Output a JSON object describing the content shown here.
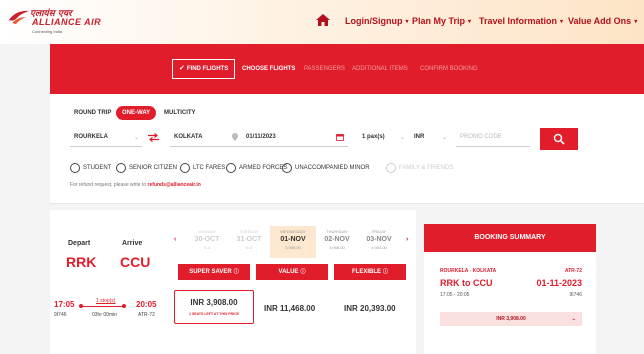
{
  "header": {
    "logo_hindi": "एलायंस एयर",
    "logo_name": "ALLIANCE AIR",
    "logo_tagline": "Connecting India",
    "nav": [
      {
        "label": "Login/Signup",
        "caret": "▾"
      },
      {
        "label": "Plan My Trip",
        "caret": "▾"
      },
      {
        "label": "Travel Information",
        "caret": "▾"
      },
      {
        "label": "Value Add Ons",
        "caret": "▾"
      }
    ]
  },
  "steps": {
    "find_flights": "FIND FLIGHTS",
    "tick": "✓",
    "choose_flights": "CHOOSE FLIGHTS",
    "passengers": "PASSENGERS",
    "additional_items": "ADDITIONAL ITEMS",
    "confirm_booking": "CONFIRM BOOKING"
  },
  "search": {
    "trip_types": [
      "ROUND TRIP",
      "ONE-WAY",
      "MULTICITY"
    ],
    "selected_trip": "ONE-WAY",
    "from": "ROURKELA",
    "to": "KOLKATA",
    "date": "01/11/2023",
    "pax": "1 pax(s)",
    "currency": "INR",
    "promo_placeholder": "PROMO CODE",
    "fare_types": [
      "STUDENT",
      "SENIOR CITIZEN",
      "LTC FARES",
      "ARMED FORCES",
      "UNACCOMPANIED MINOR",
      "FAMILY & FRIENDS"
    ],
    "refund_text": "For refund request, please write to",
    "refund_email": "refunds@allianceair.in"
  },
  "results": {
    "depart_label": "Depart",
    "arrive_label": "Arrive",
    "from_code": "RRK",
    "to_code": "CCU",
    "prev": "‹",
    "next": "›",
    "dates": [
      {
        "dow": "MONDAY",
        "dm": "30-OCT",
        "price": "N.A"
      },
      {
        "dow": "TUESDAY",
        "dm": "31-OCT",
        "price": "N.A"
      },
      {
        "dow": "WEDNESDAY",
        "dm": "01-NOV",
        "price": "3,908.00"
      },
      {
        "dow": "THURSDAY",
        "dm": "02-NOV",
        "price": "3,908.00"
      },
      {
        "dow": "FRIDAY",
        "dm": "03-NOV",
        "price": "4,903.00"
      }
    ],
    "fare_headers": [
      {
        "label": "SUPER SAVER",
        "info": "ⓘ"
      },
      {
        "label": "VALUE",
        "info": "ⓘ"
      },
      {
        "label": "FLEXIBLE",
        "info": "ⓘ"
      }
    ],
    "flight": {
      "dep_time": "17:05",
      "arr_time": "20:05",
      "stops": "1 stop(s)",
      "duration": "03hr 00min",
      "flight_no": "9I746",
      "aircraft": "ATR-72",
      "super_saver": "INR 3,908.00",
      "seats_left": "1 SEATS LEFT AT THIS PRICE",
      "value": "INR 11,468.00",
      "flexible": "INR 20,393.00"
    }
  },
  "summary": {
    "title": "BOOKING SUMMARY",
    "route": "ROURKELA - KOLKATA",
    "aircraft": "ATR-72",
    "codes": "RRK to CCU",
    "date": "01-11-2023",
    "time": "17:05 - 20:05",
    "flight_no": "9I746",
    "price": "INR 3,908.00",
    "chevron": "⌄"
  },
  "colors": {
    "brand": "#e11d2b",
    "banner": "#e11d2b",
    "header_gradient_end": "#fde4c6"
  }
}
